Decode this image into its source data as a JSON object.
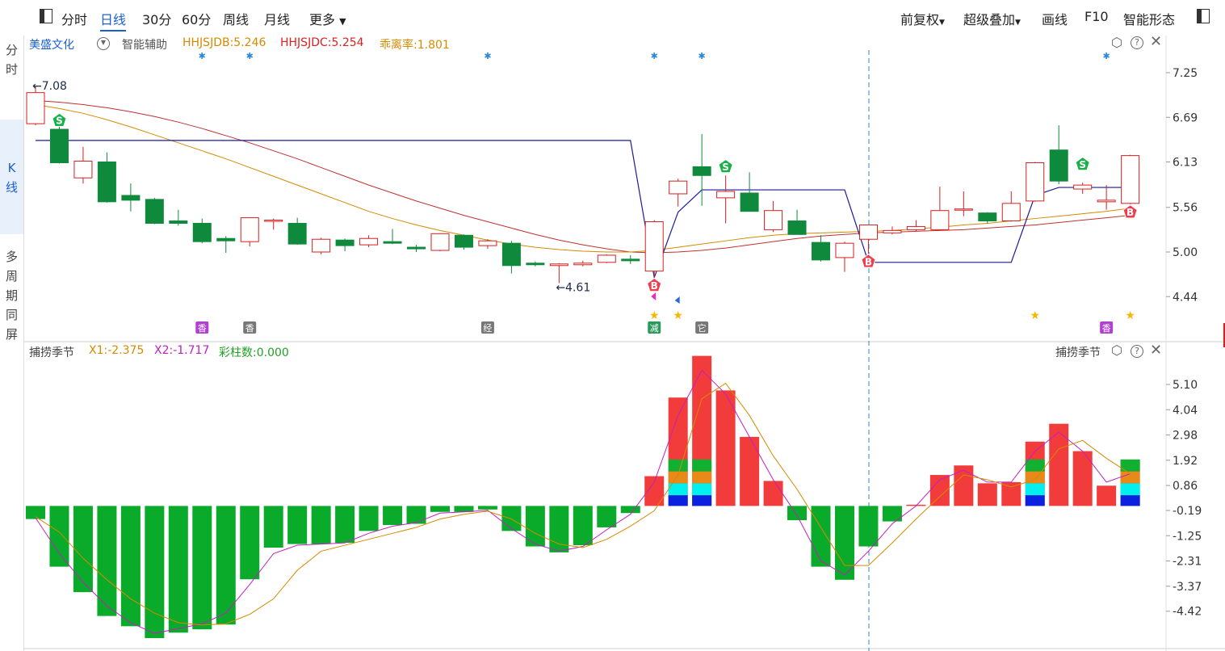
{
  "toolbar": {
    "tabs": [
      "分时",
      "日线",
      "30分",
      "60分",
      "周线",
      "月线"
    ],
    "active_tab": "日线",
    "more": "更多",
    "right": [
      "前复权",
      "超级叠加",
      "画线",
      "F10",
      "智能形态"
    ]
  },
  "sidebar": [
    "分时",
    "K线",
    "多周期同屏"
  ],
  "main_panel": {
    "stock_name": "美盛文化",
    "assist": "智能辅助",
    "legend": [
      {
        "label": "HHJSJDB:5.246",
        "color": "#d48a00"
      },
      {
        "label": "HHJSJDC:5.254",
        "color": "#e02020"
      },
      {
        "label": "乖离率:1.801",
        "color": "#d48a00"
      }
    ],
    "high_label": "7.08",
    "low_label": "4.61",
    "y_ticks": [
      "7.25",
      "6.69",
      "6.13",
      "5.56",
      "5.00",
      "4.44"
    ],
    "event_tags": [
      "香",
      "香",
      "经",
      "减",
      "它",
      "香"
    ]
  },
  "sub_panel": {
    "title": "捕捞季节",
    "title_right": "捕捞季节",
    "legend": [
      {
        "label": "X1:-2.375",
        "color": "#d48a00"
      },
      {
        "label": "X2:-1.717",
        "color": "#c020c0"
      },
      {
        "label": "彩柱数:0.000",
        "color": "#20a020"
      }
    ],
    "y_ticks": [
      "5.10",
      "4.04",
      "2.98",
      "1.92",
      "0.86",
      "-0.19",
      "-1.25",
      "-2.31",
      "-3.37",
      "-4.42"
    ]
  },
  "colors": {
    "up": "#d42020",
    "down": "#0f8a3c",
    "bar_pos": "#f23c3c",
    "bar_neg": "#0aaa2a",
    "ma1": "#d48a00",
    "ma2": "#c03030",
    "band": "#1a1a9a",
    "star": "#f5b800"
  },
  "chart_data": {
    "type": "candlestick",
    "candles": [
      {
        "o": 6.61,
        "h": 7.08,
        "l": 6.59,
        "c": 7.0
      },
      {
        "o": 6.54,
        "h": 6.62,
        "l": 6.11,
        "c": 6.12
      },
      {
        "o": 5.93,
        "h": 6.32,
        "l": 5.86,
        "c": 6.14
      },
      {
        "o": 6.13,
        "h": 6.25,
        "l": 5.62,
        "c": 5.63
      },
      {
        "o": 5.71,
        "h": 5.86,
        "l": 5.51,
        "c": 5.65
      },
      {
        "o": 5.66,
        "h": 5.68,
        "l": 5.35,
        "c": 5.36
      },
      {
        "o": 5.39,
        "h": 5.53,
        "l": 5.33,
        "c": 5.36
      },
      {
        "o": 5.36,
        "h": 5.42,
        "l": 5.11,
        "c": 5.13
      },
      {
        "o": 5.17,
        "h": 5.2,
        "l": 4.99,
        "c": 5.14
      },
      {
        "o": 5.13,
        "h": 5.43,
        "l": 5.07,
        "c": 5.43
      },
      {
        "o": 5.4,
        "h": 5.42,
        "l": 5.28,
        "c": 5.4
      },
      {
        "o": 5.36,
        "h": 5.43,
        "l": 5.09,
        "c": 5.1
      },
      {
        "o": 5.0,
        "h": 5.18,
        "l": 4.97,
        "c": 5.16
      },
      {
        "o": 5.15,
        "h": 5.17,
        "l": 5.01,
        "c": 5.08
      },
      {
        "o": 5.09,
        "h": 5.21,
        "l": 5.06,
        "c": 5.17
      },
      {
        "o": 5.13,
        "h": 5.29,
        "l": 5.1,
        "c": 5.11
      },
      {
        "o": 5.06,
        "h": 5.09,
        "l": 5.0,
        "c": 5.04
      },
      {
        "o": 5.02,
        "h": 5.23,
        "l": 5.01,
        "c": 5.23
      },
      {
        "o": 5.21,
        "h": 5.22,
        "l": 5.03,
        "c": 5.06
      },
      {
        "o": 5.08,
        "h": 5.16,
        "l": 5.04,
        "c": 5.14
      },
      {
        "o": 5.11,
        "h": 5.14,
        "l": 4.73,
        "c": 4.83
      },
      {
        "o": 4.86,
        "h": 4.88,
        "l": 4.82,
        "c": 4.84
      },
      {
        "o": 4.83,
        "h": 4.86,
        "l": 4.61,
        "c": 4.85
      },
      {
        "o": 4.84,
        "h": 4.89,
        "l": 4.82,
        "c": 4.86
      },
      {
        "o": 4.87,
        "h": 4.97,
        "l": 4.86,
        "c": 4.96
      },
      {
        "o": 4.91,
        "h": 4.96,
        "l": 4.85,
        "c": 4.89
      },
      {
        "o": 4.76,
        "h": 5.4,
        "l": 4.65,
        "c": 5.38
      },
      {
        "o": 5.73,
        "h": 5.92,
        "l": 5.57,
        "c": 5.89
      },
      {
        "o": 6.07,
        "h": 6.48,
        "l": 5.58,
        "c": 5.96
      },
      {
        "o": 5.68,
        "h": 5.96,
        "l": 5.36,
        "c": 5.76
      },
      {
        "o": 5.74,
        "h": 6.0,
        "l": 5.52,
        "c": 5.51
      },
      {
        "o": 5.28,
        "h": 5.64,
        "l": 5.25,
        "c": 5.52
      },
      {
        "o": 5.39,
        "h": 5.53,
        "l": 5.22,
        "c": 5.22
      },
      {
        "o": 5.12,
        "h": 5.21,
        "l": 4.88,
        "c": 4.9
      },
      {
        "o": 4.93,
        "h": 5.13,
        "l": 4.75,
        "c": 5.11
      },
      {
        "o": 5.16,
        "h": 5.34,
        "l": 4.97,
        "c": 5.34
      },
      {
        "o": 5.24,
        "h": 5.32,
        "l": 5.22,
        "c": 5.27
      },
      {
        "o": 5.28,
        "h": 5.4,
        "l": 5.26,
        "c": 5.32
      },
      {
        "o": 5.28,
        "h": 5.82,
        "l": 5.27,
        "c": 5.52
      },
      {
        "o": 5.53,
        "h": 5.76,
        "l": 5.45,
        "c": 5.54
      },
      {
        "o": 5.49,
        "h": 5.5,
        "l": 5.36,
        "c": 5.39
      },
      {
        "o": 5.39,
        "h": 5.76,
        "l": 5.38,
        "c": 5.61
      },
      {
        "o": 5.64,
        "h": 6.13,
        "l": 5.63,
        "c": 6.12
      },
      {
        "o": 6.28,
        "h": 6.59,
        "l": 5.85,
        "c": 5.89
      },
      {
        "o": 5.79,
        "h": 5.87,
        "l": 5.73,
        "c": 5.84
      },
      {
        "o": 5.63,
        "h": 5.84,
        "l": 5.53,
        "c": 5.65
      },
      {
        "o": 5.61,
        "h": 6.22,
        "l": 5.6,
        "c": 6.21
      }
    ],
    "band_line": [
      {
        "i": 0,
        "v": 6.4
      },
      {
        "i": 25,
        "v": 6.4
      },
      {
        "i": 26,
        "v": 4.68
      },
      {
        "i": 27,
        "v": 5.5
      },
      {
        "i": 28,
        "v": 5.78
      },
      {
        "i": 34,
        "v": 5.78
      },
      {
        "i": 35,
        "v": 4.87
      },
      {
        "i": 41,
        "v": 4.87
      },
      {
        "i": 42,
        "v": 5.71
      },
      {
        "i": 43,
        "v": 5.81
      },
      {
        "i": 46,
        "v": 5.81
      }
    ],
    "ma_a": [
      6.85,
      6.8,
      6.74,
      6.66,
      6.57,
      6.47,
      6.37,
      6.27,
      6.17,
      6.06,
      5.95,
      5.84,
      5.73,
      5.62,
      5.51,
      5.42,
      5.34,
      5.27,
      5.21,
      5.15,
      5.1,
      5.06,
      5.03,
      5.01,
      5.0,
      5.0,
      5.02,
      5.06,
      5.1,
      5.14,
      5.18,
      5.21,
      5.23,
      5.24,
      5.25,
      5.26,
      5.27,
      5.29,
      5.31,
      5.34,
      5.36,
      5.39,
      5.42,
      5.45,
      5.48,
      5.51,
      5.55
    ],
    "ma_b": [
      6.9,
      6.88,
      6.85,
      6.81,
      6.76,
      6.7,
      6.63,
      6.55,
      6.46,
      6.37,
      6.27,
      6.17,
      6.06,
      5.95,
      5.84,
      5.74,
      5.64,
      5.55,
      5.46,
      5.38,
      5.3,
      5.22,
      5.15,
      5.09,
      5.04,
      5.0,
      4.99,
      5.0,
      5.02,
      5.05,
      5.09,
      5.13,
      5.17,
      5.2,
      5.22,
      5.24,
      5.25,
      5.26,
      5.27,
      5.28,
      5.3,
      5.32,
      5.34,
      5.37,
      5.4,
      5.43,
      5.46
    ],
    "signals": [
      {
        "i": 1,
        "type": "S",
        "v": 6.65
      },
      {
        "i": 29,
        "type": "S",
        "v": 6.07
      },
      {
        "i": 44,
        "type": "S",
        "v": 6.1
      },
      {
        "i": 26,
        "type": "B",
        "v": 4.58
      },
      {
        "i": 35,
        "type": "B",
        "v": 4.88
      },
      {
        "i": 46,
        "type": "B",
        "v": 5.5
      }
    ],
    "tag_positions": [
      7,
      9,
      19,
      26,
      28,
      45
    ],
    "stars": [
      26,
      27,
      42,
      46
    ],
    "snow_markers": [
      7,
      9,
      19,
      26,
      28,
      45
    ],
    "sub": {
      "bars": [
        -0.55,
        -2.55,
        -3.62,
        -4.62,
        -5.05,
        -5.55,
        -5.32,
        -5.18,
        -4.98,
        -3.08,
        -1.75,
        -1.6,
        -1.6,
        -1.55,
        -1.05,
        -0.8,
        -0.75,
        -0.25,
        -0.25,
        -0.15,
        -1.05,
        -1.7,
        -1.95,
        -1.65,
        -0.9,
        -0.3,
        1.25,
        4.55,
        6.3,
        4.85,
        2.9,
        1.05,
        -0.6,
        -2.55,
        -3.1,
        -1.7,
        -0.65,
        0.05,
        1.3,
        1.7,
        0.95,
        1.0,
        2.7,
        3.45,
        2.3,
        0.85,
        1.95
      ],
      "x1": [
        -0.45,
        -1.1,
        -2.2,
        -3.1,
        -3.9,
        -4.5,
        -4.9,
        -5.0,
        -4.95,
        -4.55,
        -3.9,
        -2.7,
        -1.9,
        -1.65,
        -1.4,
        -1.15,
        -0.9,
        -0.55,
        -0.35,
        -0.22,
        -0.55,
        -1.15,
        -1.6,
        -1.75,
        -1.4,
        -0.85,
        -0.2,
        1.3,
        4.5,
        5.15,
        3.8,
        2.1,
        0.7,
        -0.9,
        -2.5,
        -2.5,
        -1.55,
        -0.55,
        0.4,
        1.3,
        1.1,
        0.8,
        1.1,
        2.4,
        2.75,
        2.0,
        1.35
      ],
      "x2": [
        -0.5,
        -2.0,
        -3.2,
        -4.2,
        -4.9,
        -5.35,
        -5.15,
        -4.95,
        -4.5,
        -3.3,
        -2.0,
        -1.65,
        -1.6,
        -1.55,
        -1.15,
        -0.85,
        -0.7,
        -0.3,
        -0.25,
        -0.18,
        -0.95,
        -1.6,
        -1.9,
        -1.7,
        -1.0,
        -0.35,
        1.0,
        3.8,
        5.7,
        4.7,
        2.9,
        1.1,
        -0.4,
        -2.3,
        -2.9,
        -1.9,
        -0.75,
        0.0,
        1.1,
        1.5,
        1.0,
        1.0,
        2.3,
        3.1,
        2.3,
        1.0,
        1.35
      ],
      "color_blocks": [
        {
          "i": 27,
          "blue": 0.45,
          "cyan": 0.5,
          "orange": 0.5,
          "green": 0.5
        },
        {
          "i": 28,
          "blue": 0.45,
          "cyan": 0.5,
          "orange": 0.5,
          "green": 0.5
        },
        {
          "i": 42,
          "blue": 0.45,
          "cyan": 0.5,
          "orange": 0.5,
          "green": 0.5
        },
        {
          "i": 46,
          "blue": 0.45,
          "cyan": 0.5,
          "orange": 0.5,
          "green": 0.5
        }
      ]
    }
  }
}
